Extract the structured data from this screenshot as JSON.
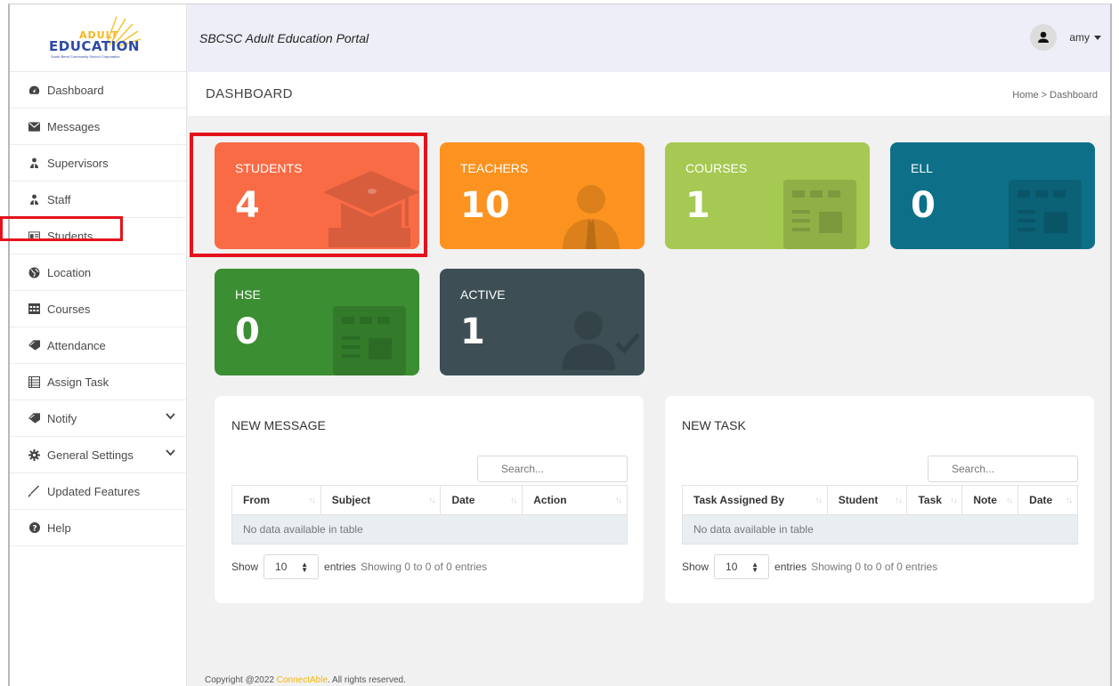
{
  "app": {
    "title": "SBCSC Adult Education Portal"
  },
  "logo": {
    "word1": "ADULT",
    "word2": "EDUCATION",
    "tagline": "South Bend Community School Corporation"
  },
  "user": {
    "name": "amy"
  },
  "sidebar": {
    "items": [
      {
        "label": "Dashboard",
        "icon": "dashboard-icon"
      },
      {
        "label": "Messages",
        "icon": "envelope-icon"
      },
      {
        "label": "Supervisors",
        "icon": "users-icon"
      },
      {
        "label": "Staff",
        "icon": "users-icon"
      },
      {
        "label": "Students",
        "icon": "id-card-icon"
      },
      {
        "label": "Location",
        "icon": "globe-icon"
      },
      {
        "label": "Courses",
        "icon": "calendar-icon"
      },
      {
        "label": "Attendance",
        "icon": "tag-icon"
      },
      {
        "label": "Assign Task",
        "icon": "list-icon"
      },
      {
        "label": "Notify",
        "icon": "tag-icon"
      },
      {
        "label": "General Settings",
        "icon": "gear-icon"
      },
      {
        "label": "Updated Features",
        "icon": "pen-icon"
      },
      {
        "label": "Help",
        "icon": "help-icon"
      }
    ]
  },
  "page": {
    "title": "DASHBOARD",
    "breadcrumb_home": "Home",
    "breadcrumb_sep": ">",
    "breadcrumb_current": "Dashboard"
  },
  "stats": {
    "students": {
      "label": "STUDENTS",
      "value": "4",
      "color": "#f96b45"
    },
    "teachers": {
      "label": "TEACHERS",
      "value": "10",
      "color": "#fc9320"
    },
    "courses": {
      "label": "COURSES",
      "value": "1",
      "color": "#a5c952"
    },
    "ell": {
      "label": "ELL",
      "value": "0",
      "color": "#0d7088"
    },
    "hse": {
      "label": "HSE",
      "value": "0",
      "color": "#3b8e32"
    },
    "active": {
      "label": "ACTIVE",
      "value": "1",
      "color": "#3d4f55"
    }
  },
  "messages_panel": {
    "title": "NEW MESSAGE",
    "search_placeholder": "Search...",
    "columns": [
      "From",
      "Subject",
      "Date",
      "Action"
    ],
    "empty": "No data available in table",
    "show": "Show",
    "length": "10",
    "entries": "entries",
    "info": "Showing 0 to 0 of 0 entries"
  },
  "tasks_panel": {
    "title": "NEW TASK",
    "search_placeholder": "Search...",
    "columns": [
      "Task Assigned By",
      "Student",
      "Task",
      "Note",
      "Date"
    ],
    "empty": "No data available in table",
    "show": "Show",
    "length": "10",
    "entries": "entries",
    "info": "Showing 0 to 0 of 0 entries"
  },
  "footer": {
    "prefix": "Copyright @2022 ",
    "brand": "ConnectAble",
    "suffix": ". All rights reserved."
  }
}
